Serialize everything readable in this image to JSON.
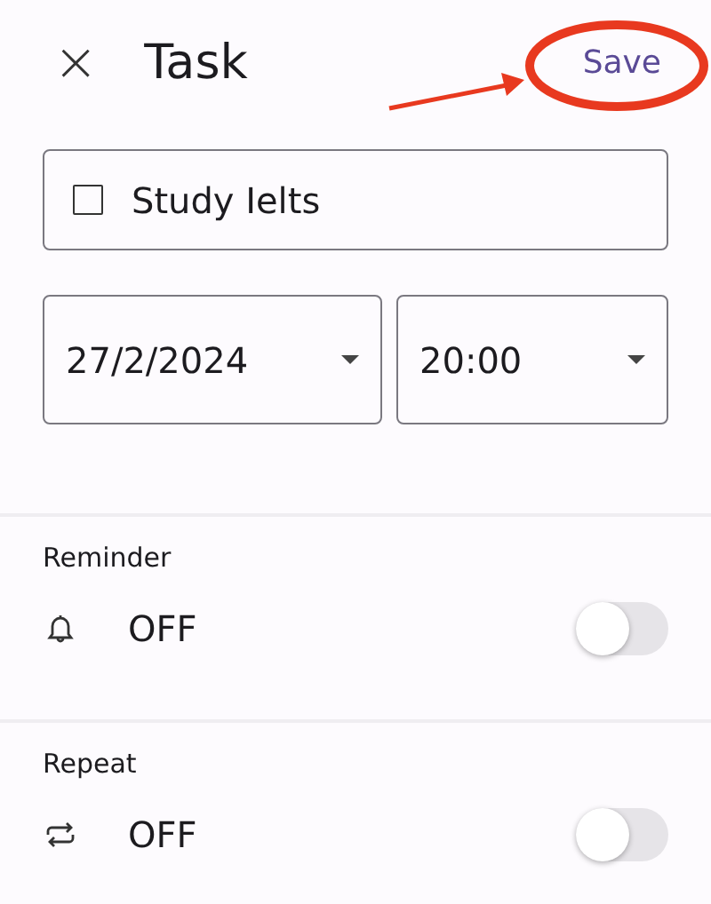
{
  "header": {
    "close": "×",
    "title": "Task",
    "save": "Save"
  },
  "task": {
    "label": "Study Ielts",
    "checked": false
  },
  "date": {
    "value": "27/2/2024"
  },
  "time": {
    "value": "20:00"
  },
  "sections": [
    {
      "kind": "reminder",
      "title": "Reminder",
      "status": "OFF",
      "on": false
    },
    {
      "kind": "repeat",
      "title": "Repeat",
      "status": "OFF",
      "on": false
    }
  ]
}
